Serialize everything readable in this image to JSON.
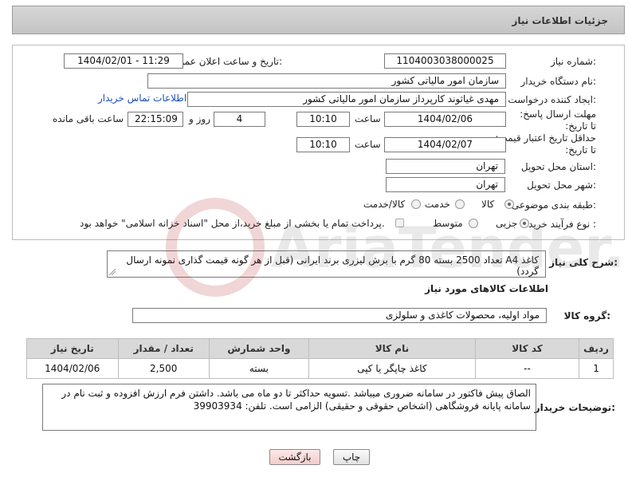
{
  "title": "جزئیات اطلاعات نیاز",
  "fields": {
    "need_number_label": "شماره نیاز:",
    "need_number": "1104003038000025",
    "announce_label": "تاریخ و ساعت اعلان عمومی:",
    "announce_value": "1404/02/01 - 11:29",
    "buyer_org_label": "نام دستگاه خریدار:",
    "buyer_org": "سازمان امور مالیاتی کشور",
    "creator_label": "ایجاد کننده درخواست:",
    "creator": "مهدی غیاثوند کارپرداز سازمان امور مالیاتی کشور",
    "contact_link": "اطلاعات تماس خریدار",
    "deadline_label": "مهلت ارسال پاسخ: تا تاریخ:",
    "deadline_date": "1404/02/06",
    "time_label": "ساعت",
    "deadline_time": "10:10",
    "days_value": "4",
    "days_label": "روز و",
    "remaining_time": "22:15:09",
    "remaining_label": "ساعت باقی مانده",
    "validity_label": "حداقل تاریخ اعتبار قیمت: تا تاریخ:",
    "validity_date": "1404/02/07",
    "validity_time": "10:10",
    "province_label": "استان محل تحویل:",
    "province": "تهران",
    "city_label": "شهر محل تحویل:",
    "city": "تهران",
    "category_label": "طبقه بندی موضوعی:",
    "category_options": [
      "کالا",
      "خدمت",
      "کالا/خدمت"
    ],
    "process_label": "نوع فرآیند خرید :",
    "process_options": [
      "جزیی",
      "متوسط"
    ],
    "payment_note": "پرداخت تمام یا بخشی از مبلغ خرید،از محل \"اسناد خزانه اسلامی\" خواهد بود."
  },
  "description": {
    "label": "شرح کلی نیاز:",
    "text": "کاغذ A4  تعداد 2500 بسته 80 گرم با برش لیزری برند ایرانی (قبل از هر گونه قیمت گذاری نمونه ارسال گردد)"
  },
  "goods_section": {
    "heading": "اطلاعات کالاهای مورد نیاز",
    "group_label": "گروه کالا:",
    "group_value": "مواد اولیه، محصولات کاغذی و سلولزی"
  },
  "table": {
    "headers": [
      "ردیف",
      "کد کالا",
      "نام کالا",
      "واحد شمارش",
      "تعداد / مقدار",
      "تاریخ نیاز"
    ],
    "rows": [
      [
        "1",
        "--",
        "کاغذ چاپگر یا کپی",
        "بسته",
        "2,500",
        "1404/02/06"
      ]
    ]
  },
  "buyer_notes": {
    "label": "توضیحات خریدار:",
    "text": "الصاق پیش فاکتور در سامانه ضروری میباشد .تسویه حداکثر تا دو ماه می باشد.  داشتن فرم ارزش افزوده و ثبت نام در سامانه پایانه فروشگاهی (اشخاص حقوقی و حقیقی) الزامی است. تلفن:  39903934"
  },
  "buttons": {
    "print": "چاپ",
    "back": "بازگشت"
  },
  "watermark_text": "AriaTender.neT",
  "colors": {
    "link": "#1a4fb5",
    "header_bg": "#d9d9d9",
    "back_button": "#f3cccc"
  }
}
